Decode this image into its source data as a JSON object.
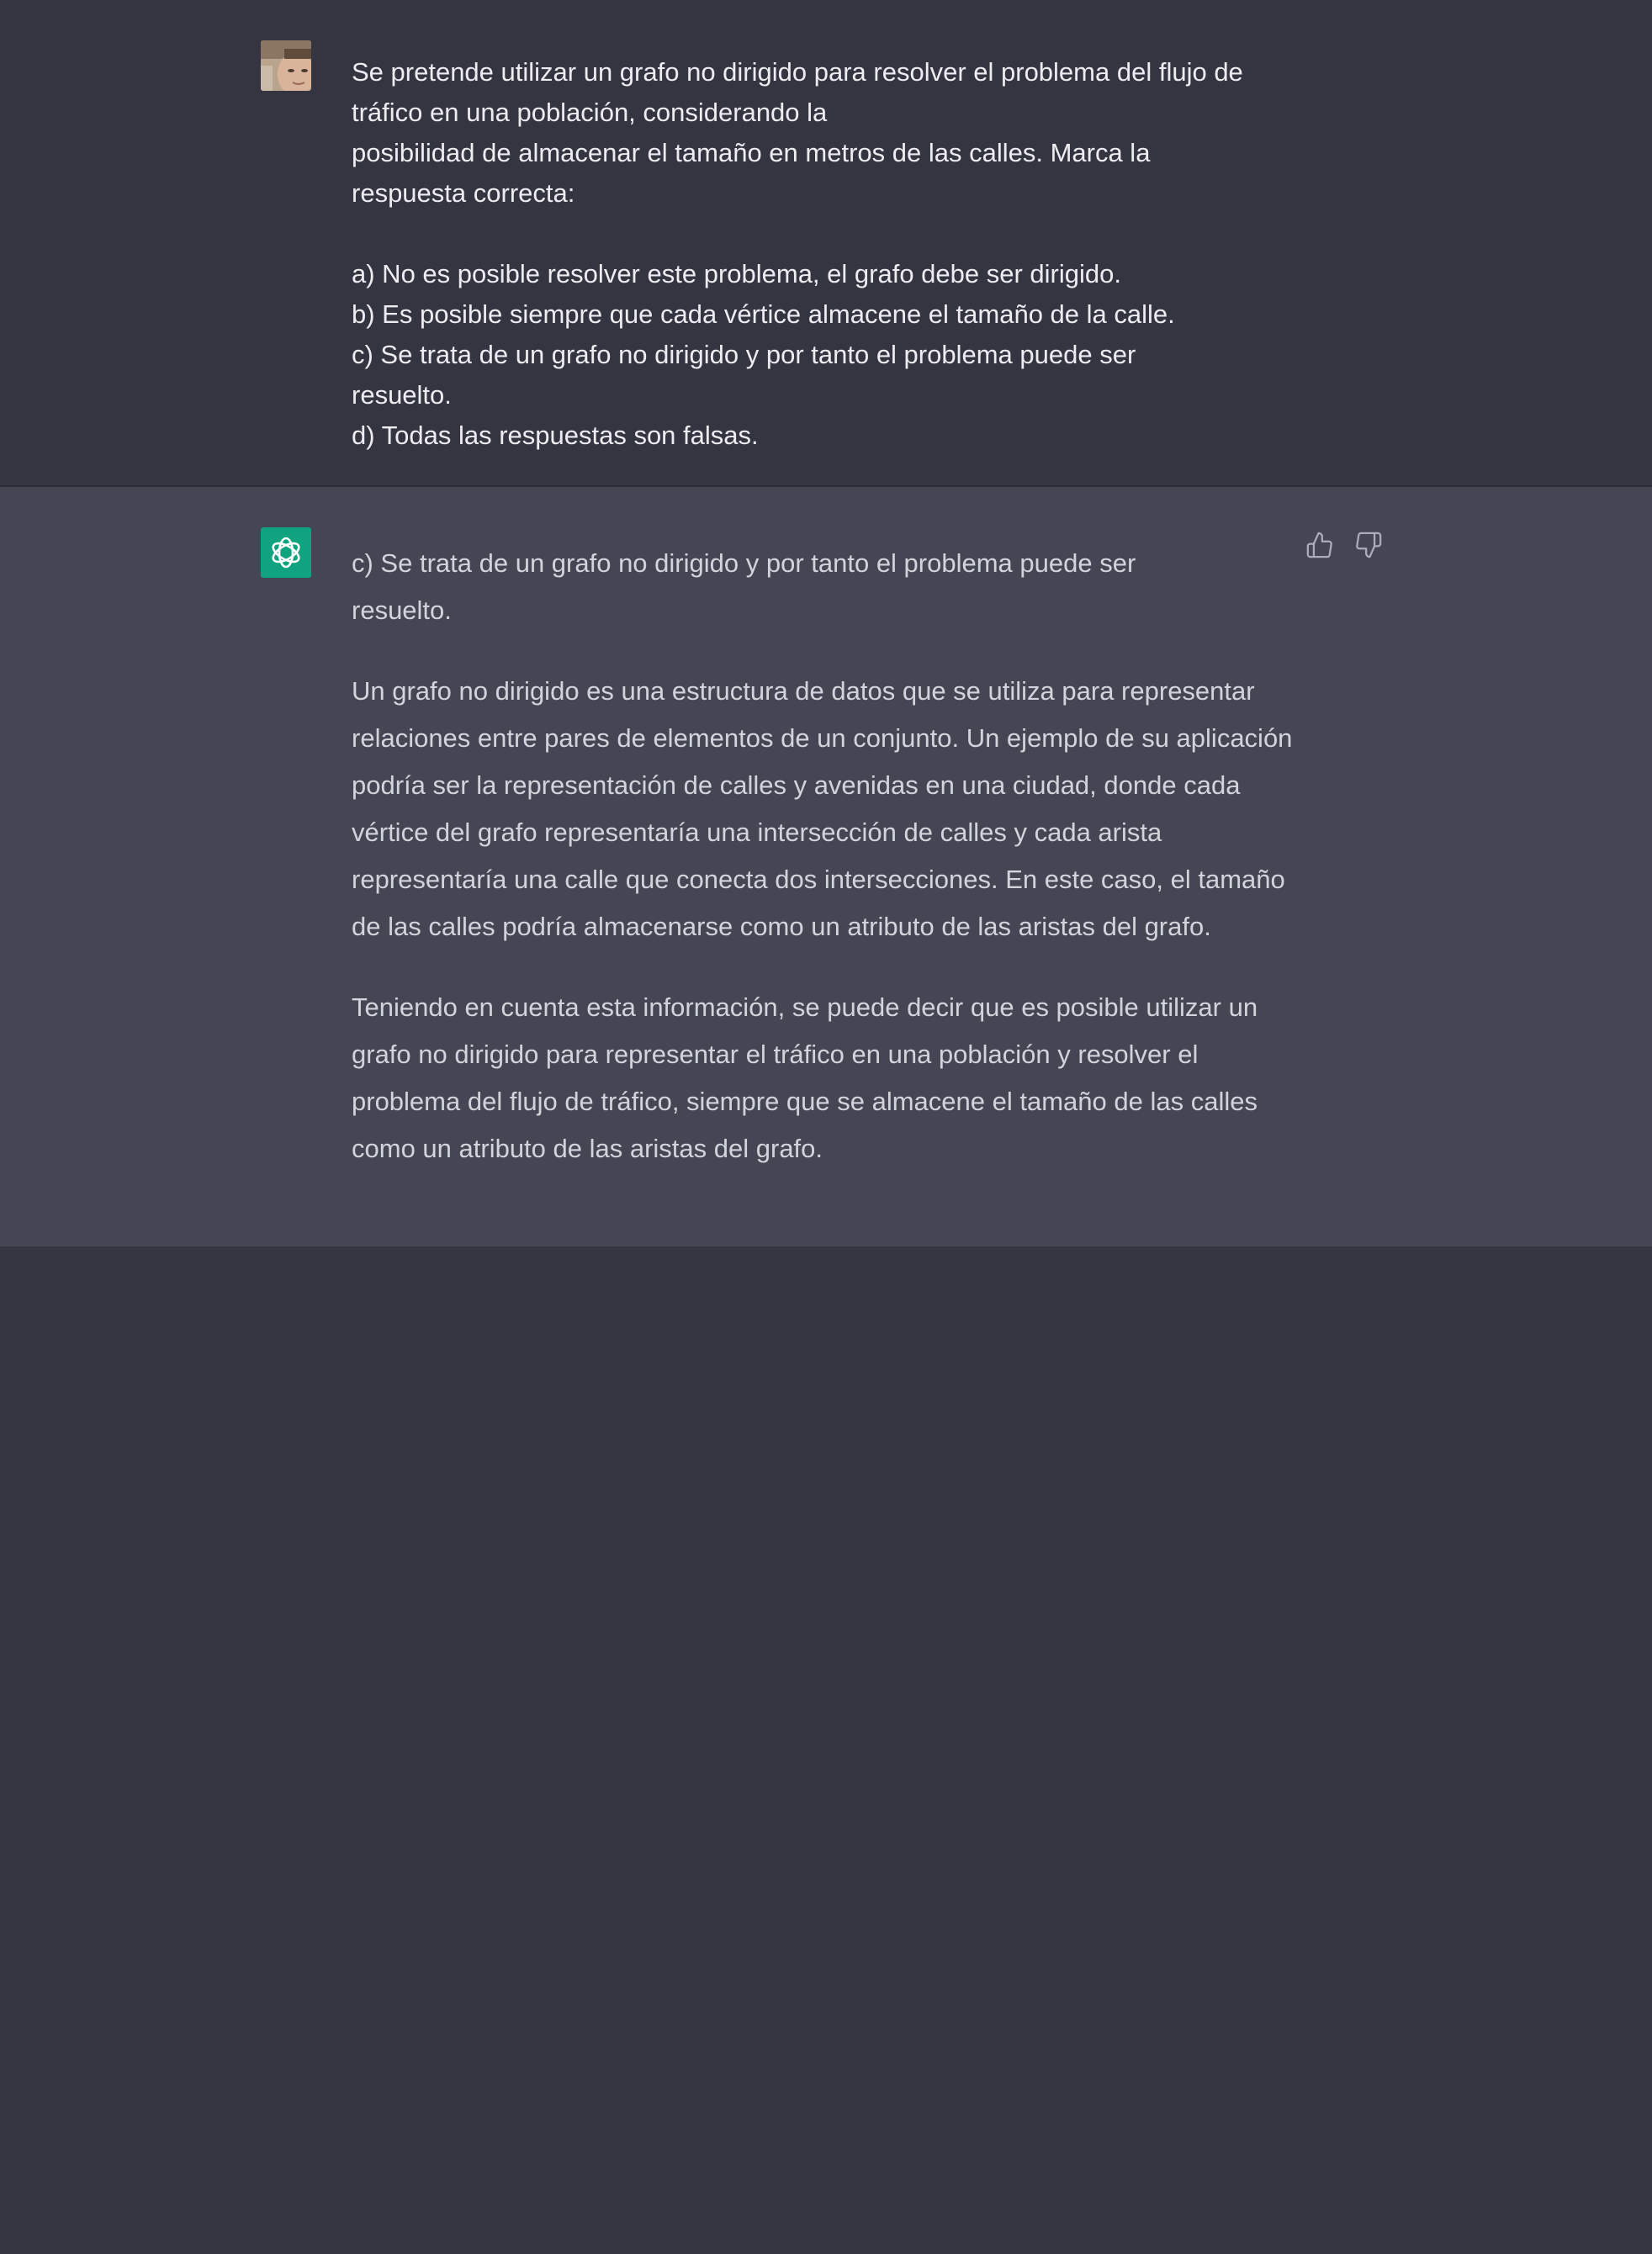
{
  "conversation": {
    "user_message": {
      "avatar_icon": "user-avatar-photo",
      "line1": "Se pretende utilizar un grafo no dirigido para resolver el problema del flujo de tráfico en una población, considerando la",
      "line2": "posibilidad de almacenar el tamaño en metros de las calles. Marca la respuesta correcta:",
      "option_a": "a) No es posible resolver este problema, el grafo debe ser dirigido.",
      "option_b": "b) Es posible siempre que cada vértice almacene el tamaño de la calle.",
      "option_c": "c) Se trata de un grafo no dirigido y por tanto el problema puede ser resuelto.",
      "option_d": "d) Todas las respuestas son falsas."
    },
    "assistant_message": {
      "avatar_icon": "openai-logo-icon",
      "avatar_color": "#10a37f",
      "paragraphs": [
        "c) Se trata de un grafo no dirigido y por tanto el problema puede ser resuelto.",
        "Un grafo no dirigido es una estructura de datos que se utiliza para representar relaciones entre pares de elementos de un conjunto. Un ejemplo de su aplicación podría ser la representación de calles y avenidas en una ciudad, donde cada vértice del grafo representaría una intersección de calles y cada arista representaría una calle que conecta dos intersecciones. En este caso, el tamaño de las calles podría almacenarse como un atributo de las aristas del grafo.",
        "Teniendo en cuenta esta información, se puede decir que es posible utilizar un grafo no dirigido para representar el tráfico en una población y resolver el problema del flujo de tráfico, siempre que se almacene el tamaño de las calles como un atributo de las aristas del grafo."
      ],
      "feedback": {
        "thumbs_up_icon": "thumbs-up-icon",
        "thumbs_down_icon": "thumbs-down-icon"
      }
    }
  },
  "colors": {
    "background": "#343541",
    "assistant_background": "#444654",
    "user_text": "#ececf1",
    "assistant_text": "#d1d5db",
    "accent": "#10a37f"
  }
}
